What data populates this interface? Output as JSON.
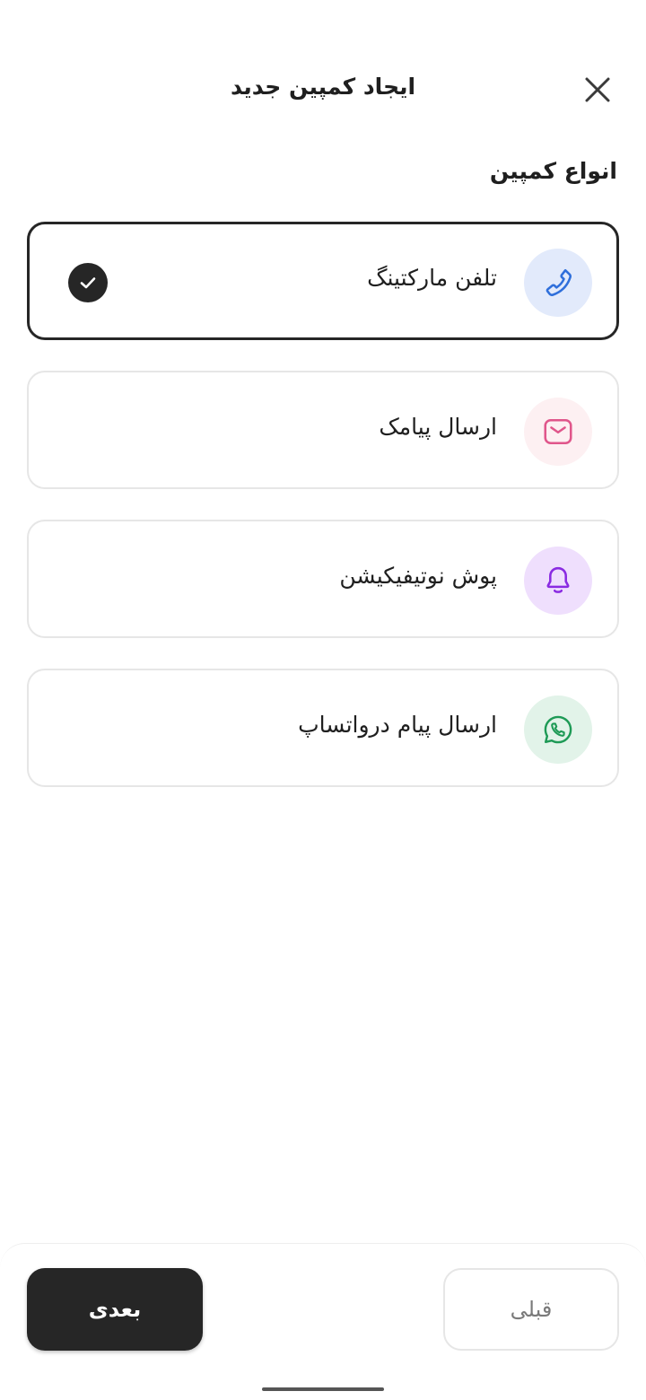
{
  "header": {
    "title": "ایجاد کمپین جدید",
    "close_icon": "close-icon"
  },
  "section": {
    "title": "انواع کمپین"
  },
  "campaign_types": [
    {
      "label": "تلفن مارکتینگ",
      "icon": "phone-icon",
      "icon_color": "#2f6fdb",
      "icon_bg": "#e2eafb",
      "selected": true
    },
    {
      "label": "ارسال پیامک",
      "icon": "mail-icon",
      "icon_color": "#e0568b",
      "icon_bg": "#fdf0f2",
      "selected": false
    },
    {
      "label": "پوش نوتیفیکیشن",
      "icon": "bell-icon",
      "icon_color": "#8a2be2",
      "icon_bg": "#efdffd",
      "selected": false
    },
    {
      "label": "ارسال پیام درواتساپ",
      "icon": "whatsapp-icon",
      "icon_color": "#1e9a56",
      "icon_bg": "#e2f3e9",
      "selected": false
    }
  ],
  "footer": {
    "next_label": "بعدی",
    "prev_label": "قبلی"
  },
  "colors": {
    "primary": "#262626",
    "border": "#e6e6e6"
  }
}
